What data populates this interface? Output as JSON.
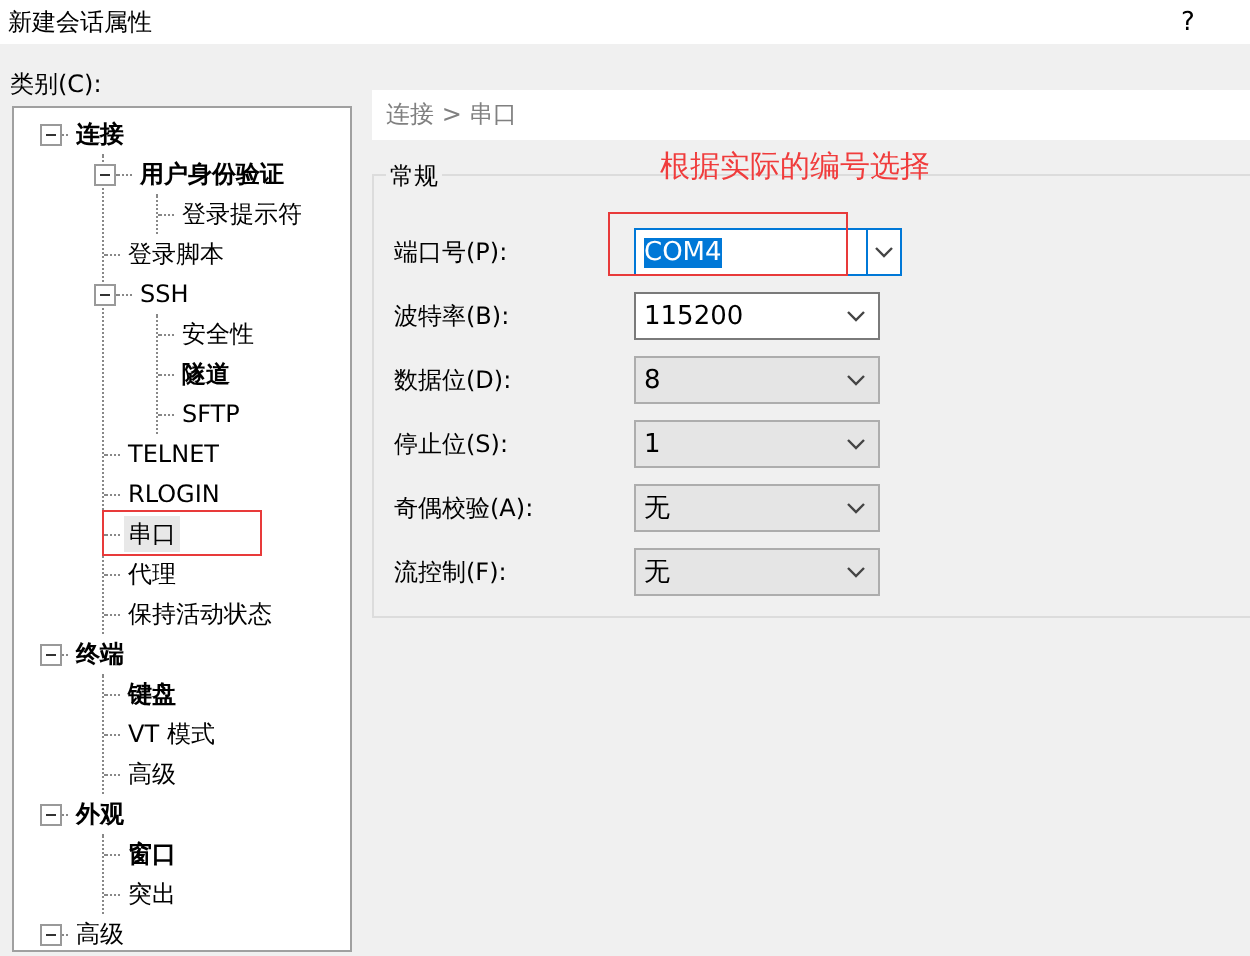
{
  "window": {
    "title": "新建会话属性",
    "help": "?"
  },
  "category_label": "类别(C):",
  "tree": [
    {
      "label": "连接",
      "bold": true,
      "expanded": true,
      "selected": false,
      "annotated": false,
      "children": [
        {
          "label": "用户身份验证",
          "bold": true,
          "expanded": true,
          "selected": false,
          "annotated": false,
          "children": [
            {
              "label": "登录提示符",
              "bold": false,
              "selected": false,
              "annotated": false
            }
          ]
        },
        {
          "label": "登录脚本",
          "bold": false,
          "selected": false,
          "annotated": false
        },
        {
          "label": "SSH",
          "bold": false,
          "expanded": true,
          "selected": false,
          "annotated": false,
          "children": [
            {
              "label": "安全性",
              "bold": false,
              "selected": false,
              "annotated": false
            },
            {
              "label": "隧道",
              "bold": true,
              "selected": false,
              "annotated": false
            },
            {
              "label": "SFTP",
              "bold": false,
              "selected": false,
              "annotated": false
            }
          ]
        },
        {
          "label": "TELNET",
          "bold": false,
          "selected": false,
          "annotated": false
        },
        {
          "label": "RLOGIN",
          "bold": false,
          "selected": false,
          "annotated": false
        },
        {
          "label": "串口",
          "bold": false,
          "selected": true,
          "annotated": true
        },
        {
          "label": "代理",
          "bold": false,
          "selected": false,
          "annotated": false
        },
        {
          "label": "保持活动状态",
          "bold": false,
          "selected": false,
          "annotated": false
        }
      ]
    },
    {
      "label": "终端",
      "bold": true,
      "expanded": true,
      "selected": false,
      "annotated": false,
      "children": [
        {
          "label": "键盘",
          "bold": true,
          "selected": false,
          "annotated": false
        },
        {
          "label": "VT 模式",
          "bold": false,
          "selected": false,
          "annotated": false
        },
        {
          "label": "高级",
          "bold": false,
          "selected": false,
          "annotated": false
        }
      ]
    },
    {
      "label": "外观",
      "bold": true,
      "expanded": true,
      "selected": false,
      "annotated": false,
      "children": [
        {
          "label": "窗口",
          "bold": true,
          "selected": false,
          "annotated": false
        },
        {
          "label": "突出",
          "bold": false,
          "selected": false,
          "annotated": false
        }
      ]
    },
    {
      "label": "高级",
      "bold": false,
      "expanded": true,
      "selected": false,
      "annotated": false
    }
  ],
  "breadcrumb": "连接 > 串口",
  "group": {
    "title": "常规",
    "note": "根据实际的编号选择",
    "fields": [
      {
        "label": "端口号(P):",
        "value": "COM4",
        "kind": "editable",
        "focused": true,
        "disabled": false,
        "annotated": true
      },
      {
        "label": "波特率(B):",
        "value": "115200",
        "kind": "dropdown",
        "focused": false,
        "disabled": false,
        "annotated": false
      },
      {
        "label": "数据位(D):",
        "value": "8",
        "kind": "dropdown",
        "focused": false,
        "disabled": true,
        "annotated": false
      },
      {
        "label": "停止位(S):",
        "value": "1",
        "kind": "dropdown",
        "focused": false,
        "disabled": true,
        "annotated": false
      },
      {
        "label": "奇偶校验(A):",
        "value": "无",
        "kind": "dropdown",
        "focused": false,
        "disabled": true,
        "annotated": false
      },
      {
        "label": "流控制(F):",
        "value": "无",
        "kind": "dropdown",
        "focused": false,
        "disabled": true,
        "annotated": false
      }
    ]
  }
}
